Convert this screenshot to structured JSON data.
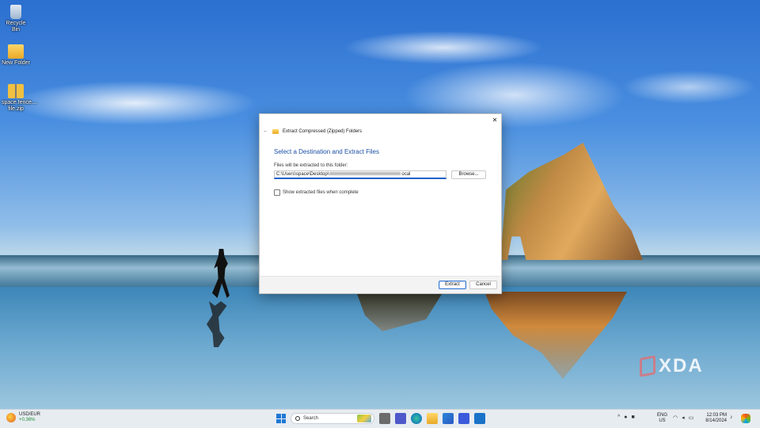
{
  "desktop": {
    "icons": [
      {
        "label": "Recycle Bin"
      },
      {
        "label": "New Folder"
      },
      {
        "label": "space.fence.... file.zip"
      }
    ],
    "watermark": "XDA"
  },
  "dialog": {
    "header_title": "Extract Compressed (Zipped) Folders",
    "close_glyph": "✕",
    "back_glyph": "←",
    "heading": "Select a Destination and Extract Files",
    "path_label": "Files will be extracted to this folder:",
    "path_prefix": "C:\\Users\\space\\Desktop\\",
    "path_suffix": "ocal",
    "browse_label": "Browse...",
    "checkbox_label": "Show extracted files when complete",
    "checkbox_checked": false,
    "extract_label": "Extract",
    "cancel_label": "Cancel"
  },
  "taskbar": {
    "ticker_symbol": "USD/EUR",
    "ticker_change": "+0.36%",
    "search_placeholder": "Search",
    "tray_chevron": "^",
    "lang_top": "ENG",
    "lang_bottom": "US",
    "time": "12:03 PM",
    "date": "8/14/2024",
    "pinned_apps": [
      "task-view",
      "teams",
      "edge",
      "file-explorer",
      "store",
      "outlook",
      "remote"
    ]
  },
  "colors": {
    "accent": "#1e62c8",
    "heading": "#1b4fa6",
    "ticker_positive": "#1f8f3a"
  }
}
